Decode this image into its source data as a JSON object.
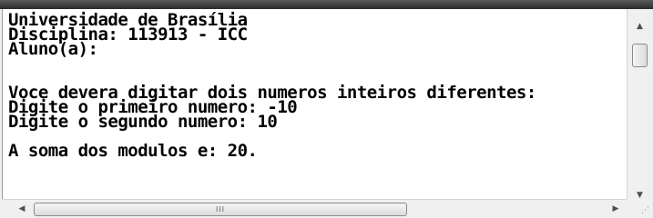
{
  "console": {
    "lines": [
      "Universidade de Brasília",
      "Disciplina: 113913 - ICC",
      "Aluno(a):",
      "",
      "",
      "Voce devera digitar dois numeros inteiros diferentes:",
      "Digite o primeiro numero: -10",
      "Digite o segundo numero: 10",
      "",
      "A soma dos modulos e: 20."
    ]
  },
  "scrollbars": {
    "vertical": {
      "up_icon": "▲",
      "down_icon": "▼"
    },
    "horizontal": {
      "left_icon": "◀",
      "right_icon": "▶",
      "grip": "III"
    }
  },
  "colors": {
    "console_background": "#ffffff",
    "console_text": "#000000",
    "chrome": "#f0f0f0"
  }
}
